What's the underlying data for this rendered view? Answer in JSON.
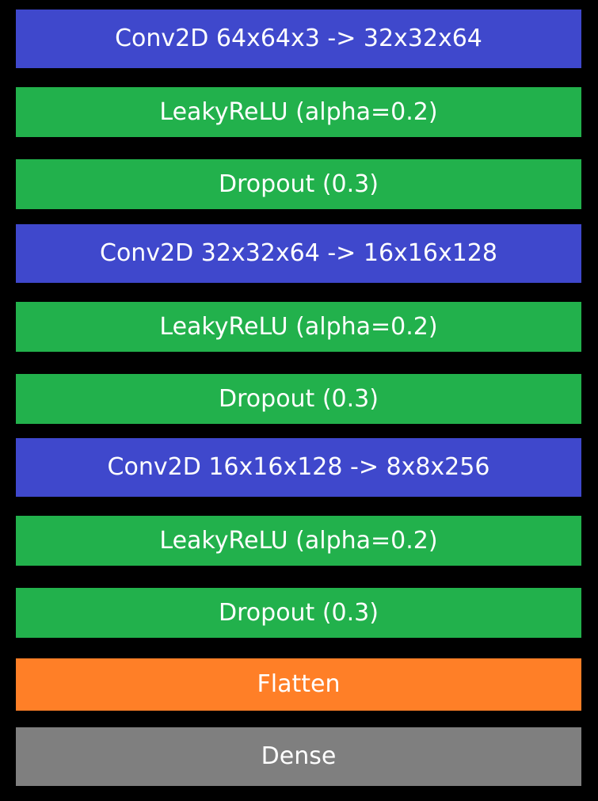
{
  "layers": [
    {
      "label": "Conv2D 64x64x3 -> 32x32x64",
      "kind": "conv",
      "color": "#3f48cc"
    },
    {
      "label": "LeakyReLU (alpha=0.2)",
      "kind": "activation",
      "color": "#22b14c"
    },
    {
      "label": "Dropout (0.3)",
      "kind": "dropout",
      "color": "#22b14c"
    },
    {
      "label": "Conv2D 32x32x64 -> 16x16x128",
      "kind": "conv",
      "color": "#3f48cc"
    },
    {
      "label": "LeakyReLU (alpha=0.2)",
      "kind": "activation",
      "color": "#22b14c"
    },
    {
      "label": "Dropout (0.3)",
      "kind": "dropout",
      "color": "#22b14c"
    },
    {
      "label": "Conv2D 16x16x128 -> 8x8x256",
      "kind": "conv",
      "color": "#3f48cc"
    },
    {
      "label": "LeakyReLU (alpha=0.2)",
      "kind": "activation",
      "color": "#22b14c"
    },
    {
      "label": "Dropout (0.3)",
      "kind": "dropout",
      "color": "#22b14c"
    },
    {
      "label": "Flatten",
      "kind": "flatten",
      "color": "#ff7f27"
    },
    {
      "label": "Dense",
      "kind": "dense",
      "color": "#7f7f7f"
    }
  ]
}
